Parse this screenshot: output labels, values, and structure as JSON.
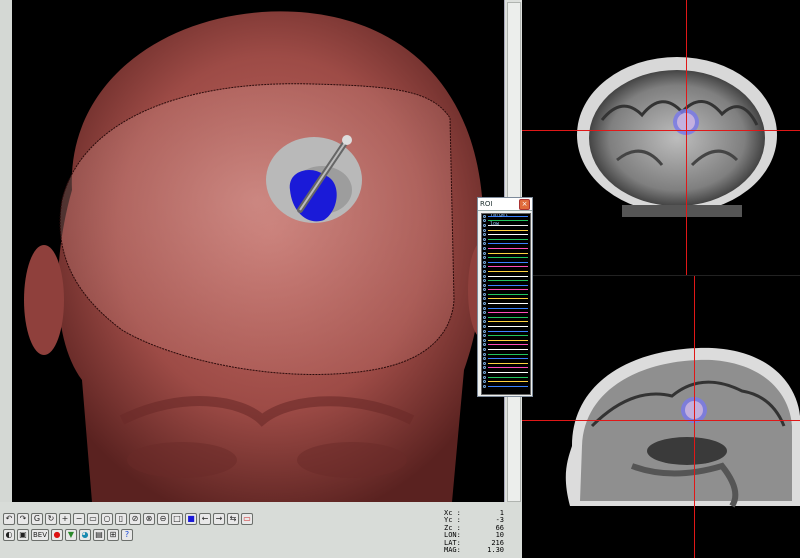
{
  "toolbar": {
    "row1": [
      "↶",
      "↷",
      "G",
      "↻",
      "+",
      "−",
      "▭",
      "○",
      "▯",
      "⊘",
      "⊗",
      "⊖",
      "□",
      "■",
      "←",
      "→",
      "⇆",
      "▭"
    ],
    "row2": [
      "◐",
      "▣",
      "BEV",
      "●",
      "▼",
      "◕",
      "▤",
      "⊞",
      "?"
    ]
  },
  "coords": [
    {
      "label": "Xc  :",
      "value": "1"
    },
    {
      "label": "Yc  :",
      "value": "-3"
    },
    {
      "label": "Zc  :",
      "value": "66"
    },
    {
      "label": "LON:",
      "value": "10"
    },
    {
      "label": "LAT:",
      "value": "216"
    },
    {
      "label": "MAG:",
      "value": "1.30"
    }
  ],
  "roi": {
    "title": "ROI",
    "close": "×",
    "items": [
      {
        "color": "#3b82ff",
        "label": "Target"
      },
      {
        "color": "#22c55e",
        "label": ""
      },
      {
        "color": "#f0f0f0",
        "label": "low"
      },
      {
        "color": "#ffd23f",
        "label": ""
      },
      {
        "color": "#ffffff",
        "label": ""
      },
      {
        "color": "#22c55e",
        "label": ""
      },
      {
        "color": "#3b82ff",
        "label": ""
      },
      {
        "color": "#ff4db8",
        "label": ""
      },
      {
        "color": "#ffd23f",
        "label": ""
      },
      {
        "color": "#22c55e",
        "label": ""
      },
      {
        "color": "#3b82ff",
        "label": ""
      },
      {
        "color": "#ff4db8",
        "label": ""
      },
      {
        "color": "#ffd23f",
        "label": ""
      },
      {
        "color": "#ffffff",
        "label": ""
      },
      {
        "color": "#22c55e",
        "label": ""
      },
      {
        "color": "#3b82ff",
        "label": ""
      },
      {
        "color": "#ff4db8",
        "label": ""
      },
      {
        "color": "#22c55e",
        "label": ""
      },
      {
        "color": "#ffd23f",
        "label": ""
      },
      {
        "color": "#ffffff",
        "label": ""
      },
      {
        "color": "#3b82ff",
        "label": ""
      },
      {
        "color": "#ff4db8",
        "label": ""
      },
      {
        "color": "#22c55e",
        "label": ""
      },
      {
        "color": "#ffd23f",
        "label": ""
      },
      {
        "color": "#ffffff",
        "label": ""
      },
      {
        "color": "#3b82ff",
        "label": ""
      },
      {
        "color": "#22c55e",
        "label": ""
      },
      {
        "color": "#ffd23f",
        "label": ""
      },
      {
        "color": "#ff4db8",
        "label": ""
      },
      {
        "color": "#ffffff",
        "label": ""
      },
      {
        "color": "#22c55e",
        "label": ""
      },
      {
        "color": "#3b82ff",
        "label": ""
      },
      {
        "color": "#ffd23f",
        "label": ""
      },
      {
        "color": "#ff4db8",
        "label": ""
      },
      {
        "color": "#ffffff",
        "label": ""
      },
      {
        "color": "#22c55e",
        "label": ""
      },
      {
        "color": "#ffd23f",
        "label": ""
      },
      {
        "color": "#3b82ff",
        "label": ""
      }
    ]
  },
  "colors": {
    "crosshair": "#e01818",
    "target": "#1a1ad8",
    "skin": "#a85450"
  }
}
